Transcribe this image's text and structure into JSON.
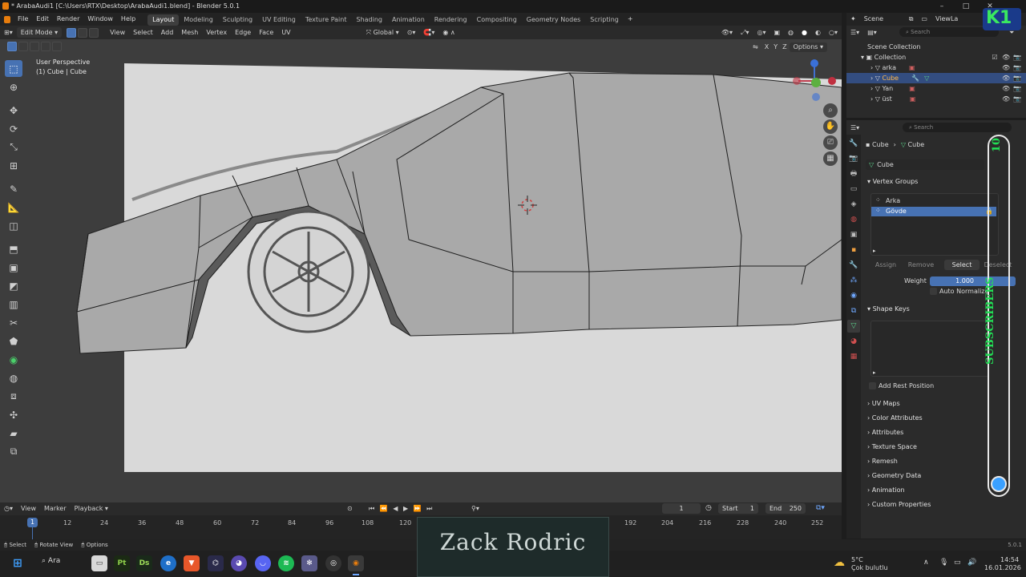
{
  "window": {
    "title": "* ArabaAudi1 [C:\\Users\\RTX\\Desktop\\ArabaAudi1.blend] - Blender 5.0.1",
    "controls": [
      "–",
      "□",
      "✕"
    ]
  },
  "menu": {
    "items": [
      "File",
      "Edit",
      "Render",
      "Window",
      "Help"
    ],
    "workspaces": [
      "Layout",
      "Modeling",
      "Sculpting",
      "UV Editing",
      "Texture Paint",
      "Shading",
      "Animation",
      "Rendering",
      "Compositing",
      "Geometry Nodes",
      "Scripting"
    ],
    "active_workspace": "Layout",
    "scene_label": "Scene",
    "view_layer_label": "ViewLa"
  },
  "viewport_header": {
    "mode": "Edit Mode",
    "menus": [
      "View",
      "Select",
      "Add",
      "Mesh",
      "Vertex",
      "Edge",
      "Face",
      "UV"
    ],
    "transform_orientation": "Global",
    "options_label": "Options",
    "axes": [
      "X",
      "Y",
      "Z"
    ]
  },
  "viewport": {
    "perspective_label": "User Perspective",
    "object_label": "(1) Cube | Cube"
  },
  "outliner": {
    "search_placeholder": "Search",
    "scene_collection": "Scene Collection",
    "collection": "Collection",
    "objects": [
      "arka",
      "Cube",
      "Yan",
      "üst"
    ],
    "selected_object": "Cube"
  },
  "properties": {
    "search_placeholder": "Search",
    "breadcrumb": [
      "Cube",
      "Cube"
    ],
    "data_name": "Cube",
    "vertex_groups_title": "Vertex Groups",
    "vertex_groups": [
      "Arka",
      "Gövde"
    ],
    "selected_vertex_group": "Gövde",
    "buttons": [
      "Assign",
      "Remove",
      "Select",
      "Deselect"
    ],
    "weight_label": "Weight",
    "weight_value": "1.000",
    "weight_fraction": 1.0,
    "auto_normalize_label": "Auto Normalize",
    "shape_keys_title": "Shape Keys",
    "add_rest_position": "Add Rest Position",
    "collapsed_sections": [
      "UV Maps",
      "Color Attributes",
      "Attributes",
      "Texture Space",
      "Remesh",
      "Geometry Data",
      "Animation",
      "Custom Properties"
    ]
  },
  "timeline": {
    "menus": [
      "View",
      "Marker",
      "Playback"
    ],
    "current_frame": "1",
    "start_label": "Start",
    "start_value": "1",
    "end_label": "End",
    "end_value": "250",
    "ticks": [
      "12",
      "24",
      "36",
      "48",
      "60",
      "72",
      "84",
      "96",
      "108",
      "120",
      "192",
      "204",
      "216",
      "228",
      "240",
      "252"
    ],
    "playhead_frame": "1"
  },
  "statusbar": {
    "items": [
      "Select",
      "Rotate View",
      "Options"
    ],
    "version": "5.0.1"
  },
  "taskbar": {
    "search_label": "Ara",
    "weather_temp": "5°C",
    "weather_desc": "Çok bulutlu",
    "time": "14:54",
    "date": "16.01.2026"
  },
  "overlay": {
    "subscribers_label": "SUBSCRIBERS",
    "subscribers_count": "10",
    "logo_text": "K1",
    "banner_text": "Zack Rodric"
  },
  "colors": {
    "accent": "#4772b3",
    "selected_row": "#334d80",
    "subscribers_green": "#22e055",
    "viewport_bg": "#3d3d3d"
  }
}
